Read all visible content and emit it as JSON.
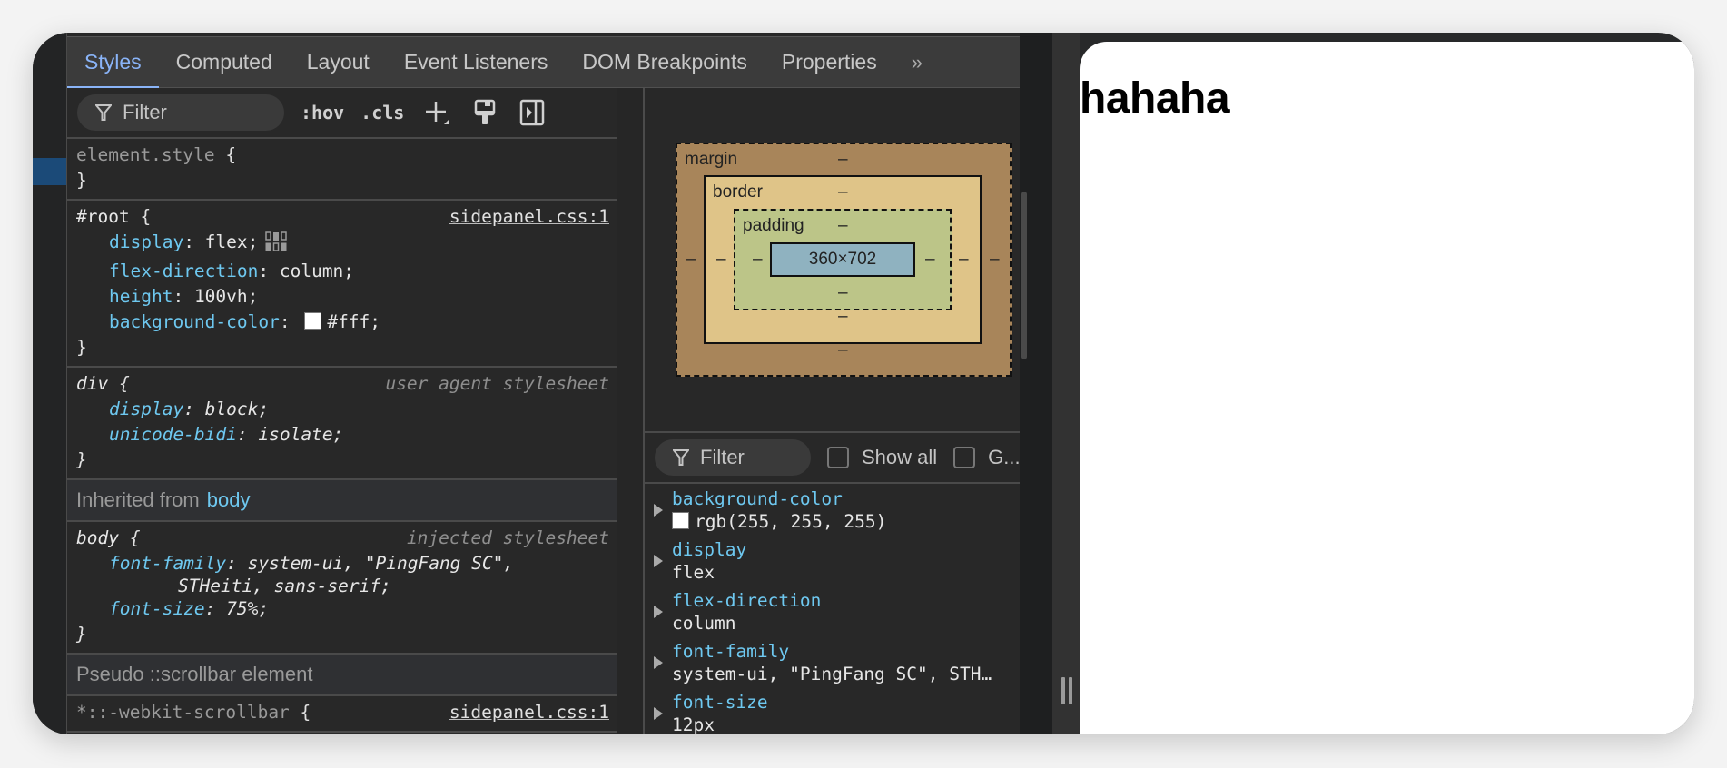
{
  "devtools": {
    "tabs": [
      {
        "label": "Styles",
        "active": true
      },
      {
        "label": "Computed",
        "active": false
      },
      {
        "label": "Layout",
        "active": false
      },
      {
        "label": "Event Listeners",
        "active": false
      },
      {
        "label": "DOM Breakpoints",
        "active": false
      },
      {
        "label": "Properties",
        "active": false
      }
    ],
    "more_tabs_icon": "»",
    "styles": {
      "filter_placeholder": "Filter",
      "hov_label": ":hov",
      "cls_label": ".cls",
      "icons": [
        "filter-icon",
        "add-rule-icon",
        "paint-brush-icon",
        "toggle-sidebar-icon"
      ],
      "element_style": {
        "selector": "element.style",
        "open": "{",
        "close": "}"
      },
      "root_rule": {
        "selector": "#root",
        "source": "sidepanel.css:1",
        "declarations": [
          {
            "prop": "display",
            "value": "flex;"
          },
          {
            "prop": "flex-direction",
            "value": "column;"
          },
          {
            "prop": "height",
            "value": "100vh;"
          },
          {
            "prop": "background-color",
            "value": "#fff;",
            "swatch": "#ffffff"
          }
        ]
      },
      "div_rule": {
        "selector": "div",
        "source": "user agent stylesheet",
        "declarations": [
          {
            "prop": "display",
            "value": "block;",
            "overridden": true
          },
          {
            "prop": "unicode-bidi",
            "value": "isolate;"
          }
        ]
      },
      "inherited_header": {
        "label": "Inherited from",
        "link": "body"
      },
      "body_rule": {
        "selector": "body",
        "source": "injected stylesheet",
        "declarations": [
          {
            "prop": "font-family",
            "value": "system-ui, \"PingFang SC\",",
            "continuation": "STHeiti, sans-serif;"
          },
          {
            "prop": "font-size",
            "value": "75%;"
          }
        ]
      },
      "pseudo_header": "Pseudo ::scrollbar element",
      "scrollbar_rule": {
        "selector": "*::-webkit-scrollbar",
        "source": "sidepanel.css:1"
      }
    },
    "box_model": {
      "margin_label": "margin",
      "border_label": "border",
      "padding_label": "padding",
      "content_size": "360×702",
      "margin": {
        "top": "–",
        "right": "–",
        "bottom": "–",
        "left": "–"
      },
      "border": {
        "top": "–",
        "right": "–",
        "bottom": "–",
        "left": "–"
      },
      "padding": {
        "top": "–",
        "right": "–",
        "bottom": "–",
        "left": "–"
      }
    },
    "computed": {
      "filter_placeholder": "Filter",
      "show_all_label": "Show all",
      "group_label": "G...",
      "properties": [
        {
          "name": "background-color",
          "value": "rgb(255, 255, 255)",
          "swatch": "#ffffff"
        },
        {
          "name": "display",
          "value": "flex"
        },
        {
          "name": "flex-direction",
          "value": "column"
        },
        {
          "name": "font-family",
          "value": "system-ui, \"PingFang SC\", STH…"
        },
        {
          "name": "font-size",
          "value": "12px"
        }
      ]
    }
  },
  "preview": {
    "heading": "hahaha"
  },
  "colors": {
    "accent": "#8ab4f8",
    "property": "#6ec8f0",
    "margin": "#a8855a",
    "border": "#dfc488",
    "padding": "#bcc588",
    "content": "#8fb2c0"
  }
}
